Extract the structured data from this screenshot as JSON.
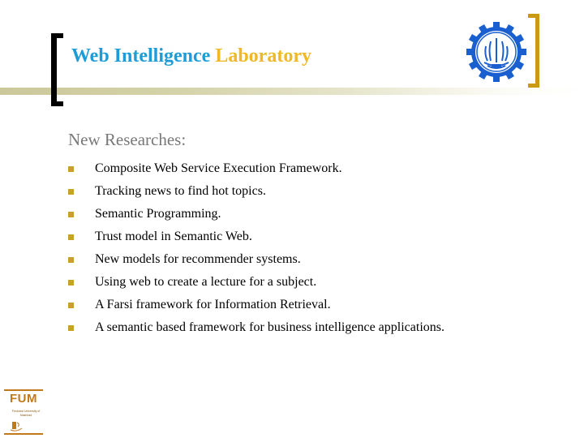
{
  "header": {
    "title_part1": "Web Intelligence",
    "title_part2": "Laboratory",
    "title_color_part1": "#1e9cd7",
    "title_color_part2": "#f0b823",
    "university_logo": "sharif-university-logo",
    "logo_color": "#1a5fd0"
  },
  "content": {
    "subtitle": "New Researches:",
    "bullet_color": "#c8a02a",
    "items": [
      "Composite Web Service Execution Framework.",
      "Tracking news to find hot topics.",
      "Semantic Programming.",
      "Trust model in Semantic Web.",
      "New models for recommender systems.",
      "Using web to create a lecture for a subject.",
      "A Farsi framework for Information Retrieval.",
      "A semantic based framework for business intelligence applications."
    ]
  },
  "footer": {
    "logo_text": "FUM",
    "logo_subtext": "Ferdowsi University of Mashhad",
    "logo_color": "#c07a1c"
  }
}
